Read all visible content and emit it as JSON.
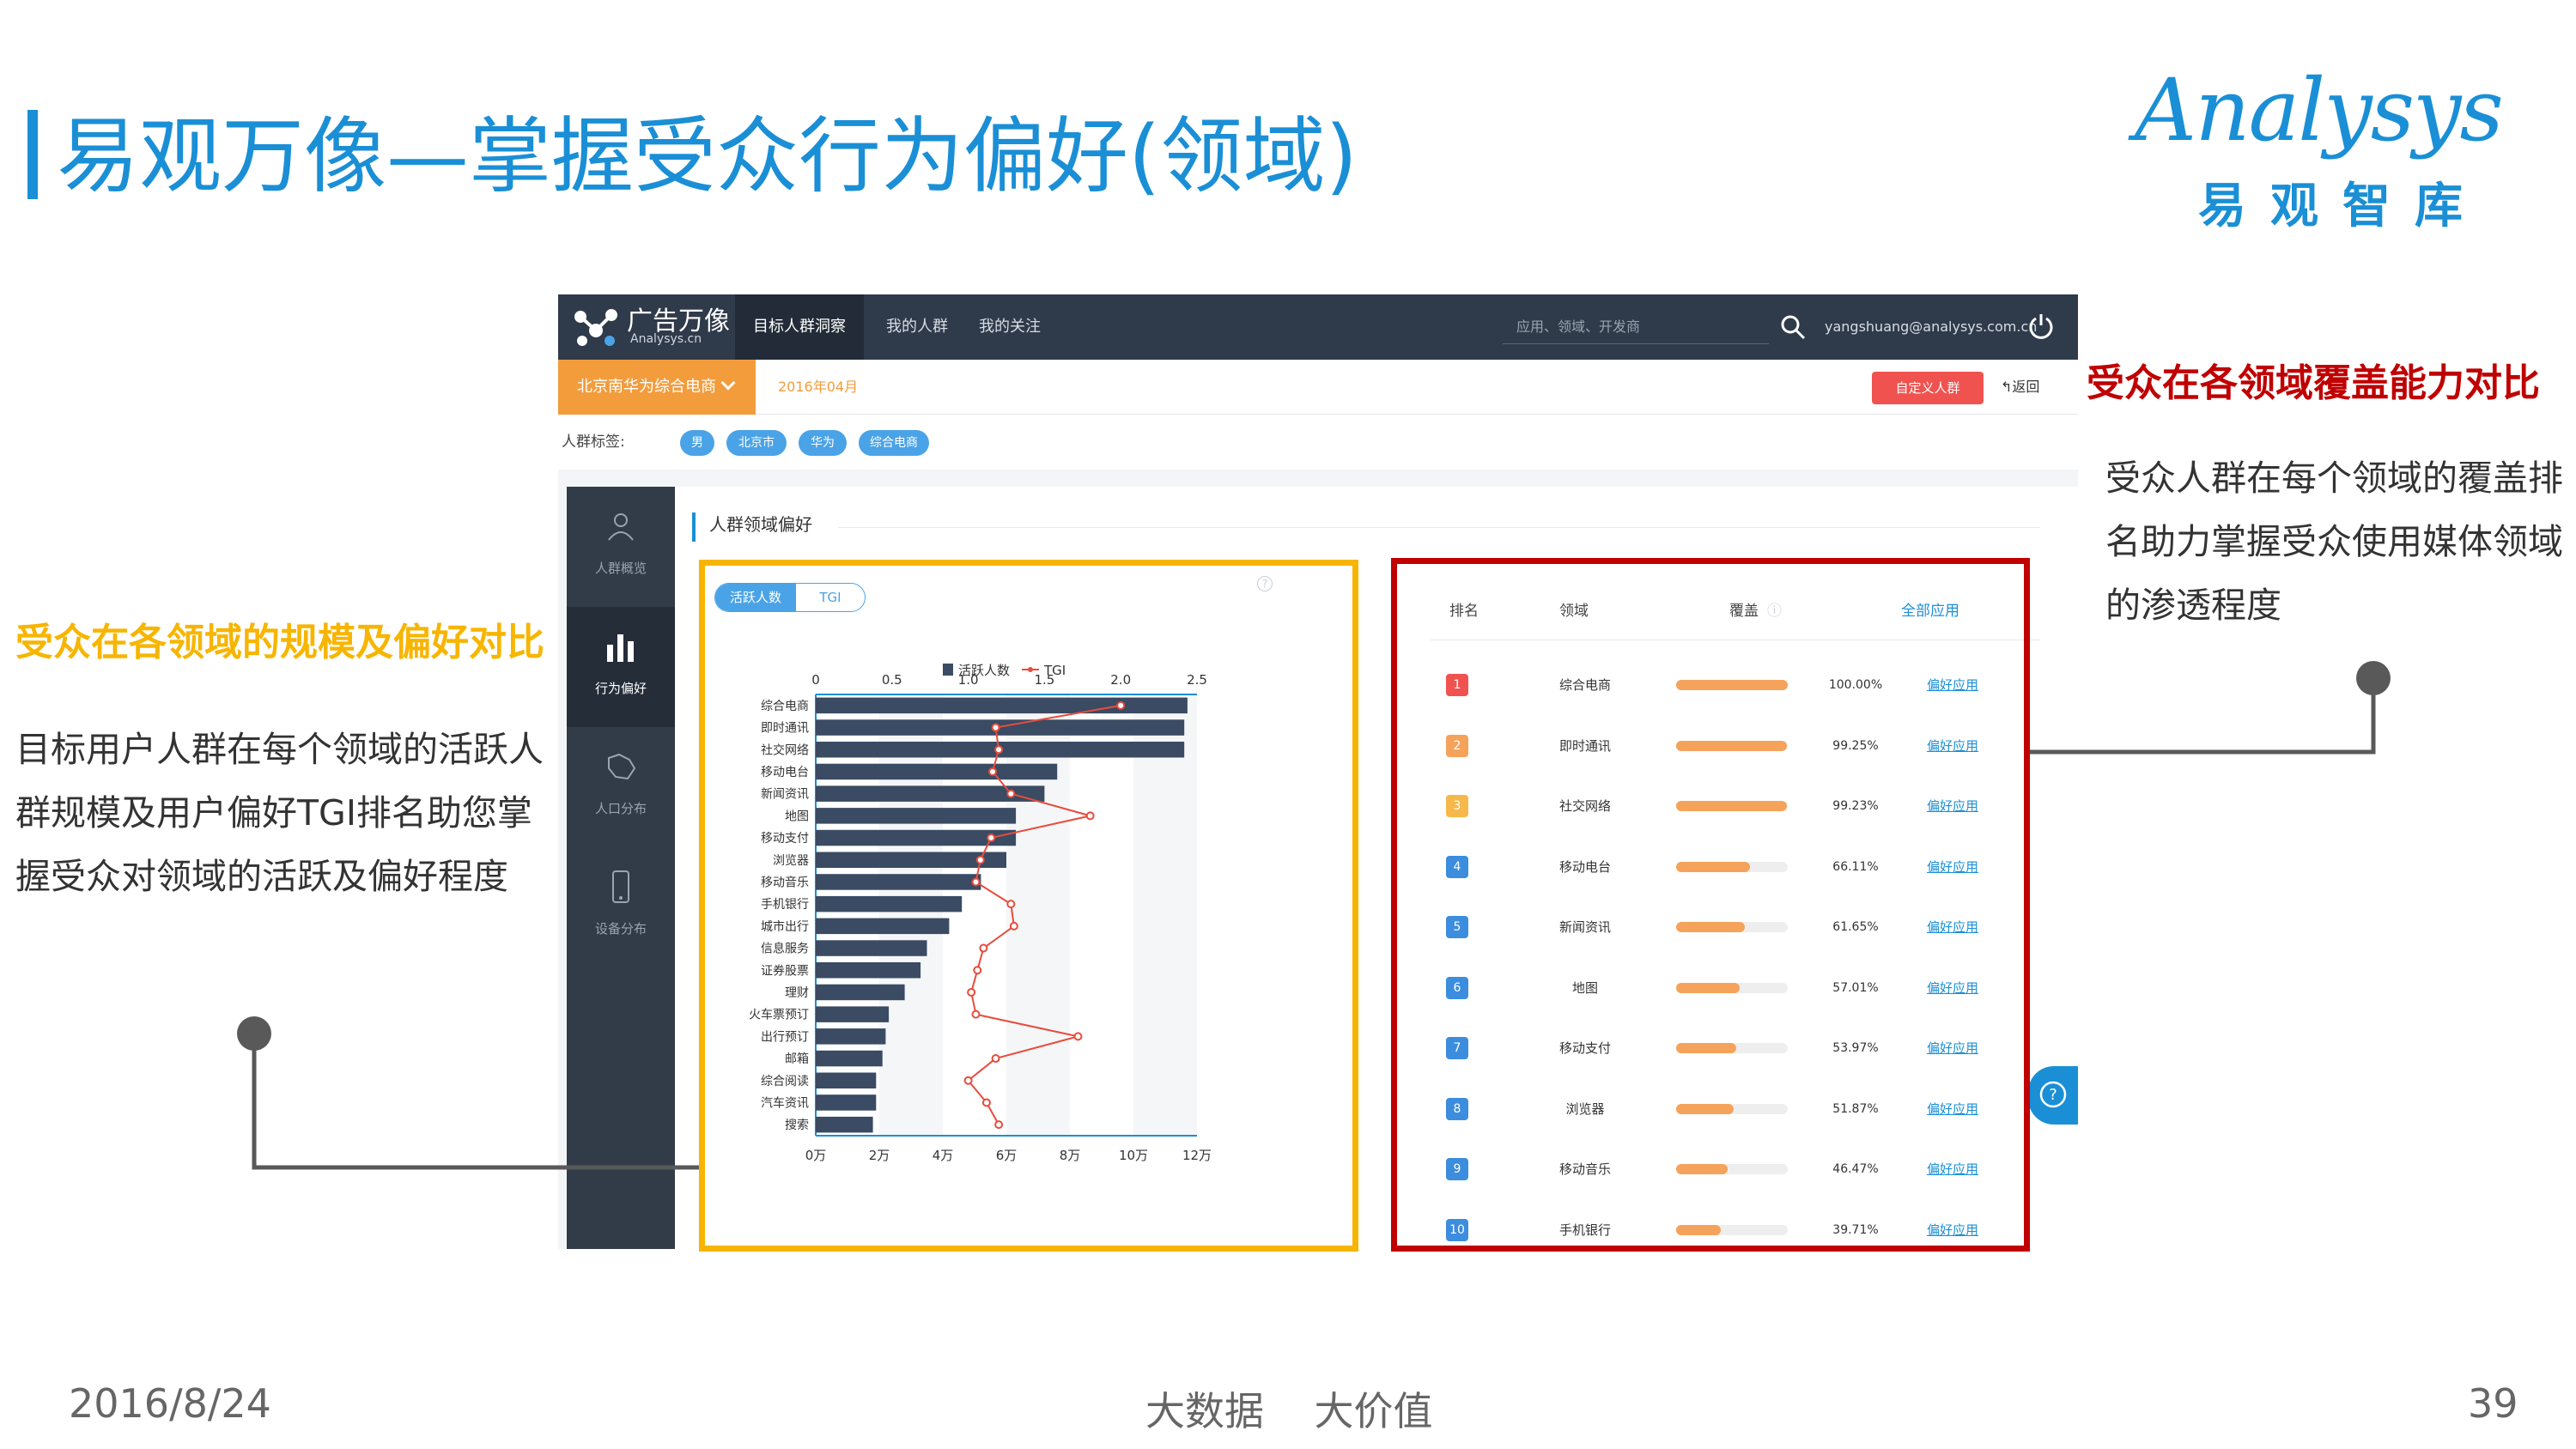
{
  "slide": {
    "title": "易观万像—掌握受众行为偏好(领域)",
    "logo_en": "Analysys",
    "logo_cn": "易观智库",
    "footer_date": "2016/8/24",
    "footer_center": "大数据    大价值",
    "page_number": "39"
  },
  "colors": {
    "brand_blue": "#1a8fd6",
    "highlight_yellow": "#f7b500",
    "highlight_red": "#c00000",
    "nav_dark": "#2f3a4a",
    "orange": "#f39c3c",
    "bar_navy": "#3a4b63",
    "tgi_red": "#e74c3c"
  },
  "app": {
    "brand_name": "广告万像",
    "brand_sub": "Analysys.cn",
    "nav_tabs": [
      "目标人群洞察",
      "我的人群",
      "我的关注"
    ],
    "search_placeholder": "应用、领域、开发商",
    "user_email": "yangshuang@analysys.com.cn",
    "crowd_select": "北京南华为综合电商",
    "date": "2016年04月",
    "custom_button": "自定义人群",
    "back_link": "返回",
    "tag_label": "人群标签:",
    "tags": [
      "男",
      "北京市",
      "华为",
      "综合电商"
    ],
    "sidebar": [
      {
        "label": "人群概览",
        "icon": "people-icon"
      },
      {
        "label": "行为偏好",
        "icon": "bar-chart-icon"
      },
      {
        "label": "人口分布",
        "icon": "map-icon"
      },
      {
        "label": "设备分布",
        "icon": "phone-icon"
      }
    ],
    "section_title": "人群领域偏好",
    "toggle": {
      "active": "活跃人数",
      "inactive": "TGI"
    },
    "table": {
      "headers": {
        "rank": "排名",
        "domain": "领域",
        "coverage": "覆盖",
        "all_apps": "全部应用"
      },
      "pref_link": "偏好应用",
      "rows": [
        {
          "rank": "1",
          "domain": "综合电商",
          "pct": "100.00%",
          "value": 100.0,
          "color": "#f0534f"
        },
        {
          "rank": "2",
          "domain": "即时通讯",
          "pct": "99.25%",
          "value": 99.25,
          "color": "#f5a35a"
        },
        {
          "rank": "3",
          "domain": "社交网络",
          "pct": "99.23%",
          "value": 99.23,
          "color": "#f7b84b"
        },
        {
          "rank": "4",
          "domain": "移动电台",
          "pct": "66.11%",
          "value": 66.11,
          "color": "#3c8dde"
        },
        {
          "rank": "5",
          "domain": "新闻资讯",
          "pct": "61.65%",
          "value": 61.65,
          "color": "#3c8dde"
        },
        {
          "rank": "6",
          "domain": "地图",
          "pct": "57.01%",
          "value": 57.01,
          "color": "#3c8dde"
        },
        {
          "rank": "7",
          "domain": "移动支付",
          "pct": "53.97%",
          "value": 53.97,
          "color": "#3c8dde"
        },
        {
          "rank": "8",
          "domain": "浏览器",
          "pct": "51.87%",
          "value": 51.87,
          "color": "#3c8dde"
        },
        {
          "rank": "9",
          "domain": "移动音乐",
          "pct": "46.47%",
          "value": 46.47,
          "color": "#3c8dde"
        },
        {
          "rank": "10",
          "domain": "手机银行",
          "pct": "39.71%",
          "value": 39.71,
          "color": "#3c8dde"
        }
      ]
    }
  },
  "annotations": {
    "left_title": "受众在各领域的规模及偏好对比",
    "left_body": "目标用户人群在每个领域的活跃人群规模及用户偏好TGI排名助您掌握受众对领域的活跃及偏好程度",
    "right_title": "受众在各领域覆盖能力对比",
    "right_body": "受众人群在每个领域的覆盖排名助力掌握受众使用媒体领域的渗透程度"
  },
  "chart_data": {
    "type": "bar",
    "orientation": "horizontal",
    "legend": [
      "活跃人数",
      "TGI"
    ],
    "categories": [
      "综合电商",
      "即时通讯",
      "社交网络",
      "移动电台",
      "新闻资讯",
      "地图",
      "移动支付",
      "浏览器",
      "移动音乐",
      "手机银行",
      "城市出行",
      "信息服务",
      "证券股票",
      "理财",
      "火车票预订",
      "出行预订",
      "邮箱",
      "综合阅读",
      "汽车资讯",
      "搜索"
    ],
    "x_bottom": {
      "label": "活跃人数",
      "ticks": [
        "0万",
        "2万",
        "4万",
        "6万",
        "8万",
        "10万",
        "12万"
      ],
      "range": [
        0,
        12
      ]
    },
    "x_top": {
      "label": "TGI",
      "ticks": [
        "0",
        "0.5",
        "1.0",
        "1.5",
        "2.0",
        "2.5"
      ],
      "range": [
        0,
        2.5
      ]
    },
    "series": [
      {
        "name": "活跃人数",
        "values": [
          11.7,
          11.6,
          11.6,
          7.6,
          7.2,
          6.3,
          6.3,
          6.0,
          5.2,
          4.6,
          4.2,
          3.5,
          3.3,
          2.8,
          2.3,
          2.2,
          2.1,
          1.9,
          1.9,
          1.8
        ]
      },
      {
        "name": "TGI",
        "values": [
          2.0,
          1.18,
          1.2,
          1.16,
          1.28,
          1.8,
          1.15,
          1.08,
          1.05,
          1.28,
          1.3,
          1.1,
          1.06,
          1.02,
          1.05,
          1.72,
          1.18,
          1.0,
          1.12,
          1.2
        ]
      }
    ],
    "grid": true
  }
}
